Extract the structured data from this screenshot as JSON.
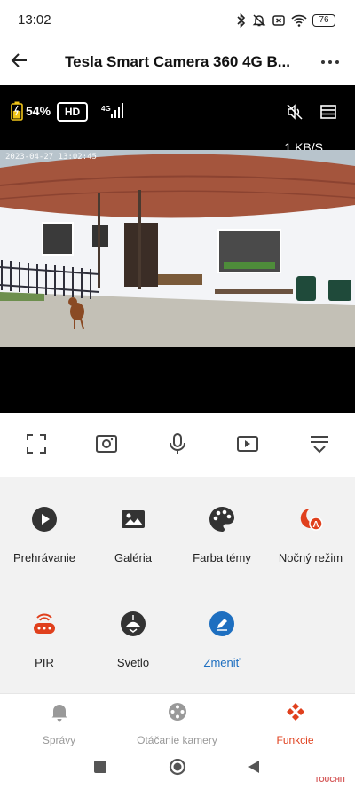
{
  "status": {
    "time": "13:02",
    "battery": "76",
    "icons": [
      "bluetooth-icon",
      "bell-off-icon",
      "sim-off-icon",
      "wifi-icon",
      "battery-icon"
    ]
  },
  "header": {
    "title": "Tesla Smart Camera 360 4G B...",
    "back_icon": "arrow-left-icon",
    "more_icon": "more-horizontal-icon"
  },
  "video": {
    "battery_percent": "54%",
    "quality": "HD",
    "network": "4G",
    "speed": "1 KB/S",
    "timestamp": "2023-04-27 13:02:45"
  },
  "controls": [
    {
      "name": "fullscreen-icon"
    },
    {
      "name": "screenshot-icon"
    },
    {
      "name": "microphone-icon"
    },
    {
      "name": "record-icon"
    },
    {
      "name": "collapse-icon"
    }
  ],
  "functions": [
    {
      "label": "Prehrávanie",
      "icon": "play-icon",
      "color": "#333333"
    },
    {
      "label": "Galéria",
      "icon": "gallery-icon",
      "color": "#333333"
    },
    {
      "label": "Farba témy",
      "icon": "palette-icon",
      "color": "#333333"
    },
    {
      "label": "Nočný režim",
      "icon": "night-mode-icon",
      "color": "#e0401d"
    },
    {
      "label": "PIR",
      "icon": "pir-sensor-icon",
      "color": "#e0401d"
    },
    {
      "label": "Svetlo",
      "icon": "light-icon",
      "color": "#333333"
    },
    {
      "label": "Zmeniť",
      "icon": "edit-icon",
      "color": "#1e6fc0"
    }
  ],
  "bottom_nav": [
    {
      "label": "Správy",
      "icon": "bell-icon",
      "active": false
    },
    {
      "label": "Otáčanie kamery",
      "icon": "camera-rotate-icon",
      "active": false
    },
    {
      "label": "Funkcie",
      "icon": "functions-icon",
      "active": true
    }
  ],
  "colors": {
    "accent": "#e0401d",
    "link": "#1e6fc0",
    "video_bg": "#000000"
  },
  "watermark": "TOUCHIT"
}
